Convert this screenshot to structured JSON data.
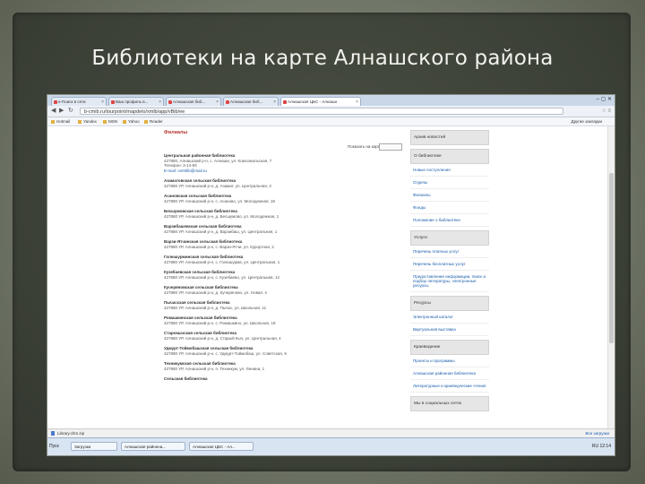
{
  "slide": {
    "title": "Библиотеки на карте Алнашского района"
  },
  "browser": {
    "tabs": [
      {
        "label": "e-Поиск в сети"
      },
      {
        "label": "Ваш профиль в..."
      },
      {
        "label": "Алнашская биб..."
      },
      {
        "label": "Алнашская биб..."
      },
      {
        "label": "Алнашская ЦБС - Алнаши"
      }
    ],
    "url": "b-cmib.ru/tourpoint/mapdelo/xmlb/app/vBib/ee",
    "bookmarks": [
      "Hotmail",
      "Yandex",
      "MSN",
      "Yahoo",
      "Reader"
    ],
    "other_bookmarks": "Другие закладки",
    "download": "Library.chm.zip",
    "download_all": "Все загрузки"
  },
  "main": {
    "heading": "Филиалы",
    "addr_label": "Показать на карте",
    "libraries": [
      {
        "name": "Центральная районная библиотека",
        "address": "427880, Алнашский р-н, с. Алнаши, ул. Комсомольская, 7",
        "phone": "Телефон: 3-14-93",
        "email": "E-mail: centrlib@mail.ru"
      },
      {
        "name": "Азаматовская сельская библиотека",
        "address": "427886 УР, Алнашский р-н, д. Азамат, ул. Центральная, 3"
      },
      {
        "name": "Асановская сельская библиотека",
        "address": "427880 УР, Алнашский р-н, с. Асаново, ул. Молодежная, 18"
      },
      {
        "name": "Бесшумовская сельская библиотека",
        "address": "427880 УР, Алнашский р-н, д. Бесшумово, ул. Молодежная, 1"
      },
      {
        "name": "Варзибашевская сельская библиотека",
        "address": "427880 УР, Алнашский р-н, д. Варзибаш, ул. Центральная, 1"
      },
      {
        "name": "Варзи-Ятчинская сельская библиотека",
        "address": "427880 УР, Алнашский р-н, с. Варзи-Ятчи, ул. Курортная, 2"
      },
      {
        "name": "Голюшурминская сельская библиотека",
        "address": "427880 УР, Алнашский р-н, с. Голюшурма, ул. Центральная, 1"
      },
      {
        "name": "Кузебаевская сельская библиотека",
        "address": "427880 УР, Алнашский р-н, с. Кузебаево, ул. Центральная, 12"
      },
      {
        "name": "Кучеряновская сельская библиотека",
        "address": "427880 УР, Алнашский р-н, д. Кучеряново, ул. Новая, 4"
      },
      {
        "name": "Пычасская сельская библиотека",
        "address": "427880 УР, Алнашский р-н, д. Пычас, ул. Школьная, 11"
      },
      {
        "name": "Ромашкинская сельская библиотека",
        "address": "427880 УР, Алнашский р-н, с. Ромашкино, ул. Школьная, 18"
      },
      {
        "name": "Старокычская сельская библиотека",
        "address": "427880 УР, Алнашский р-н, д. Старый Кыч, ул. Центральная, 4"
      },
      {
        "name": "Удмурт-Тоймобашская сельская библиотека",
        "address": "427880 УР, Алнашский р-н, с. Удмурт-Тоймобаш, ул. Советская, 9"
      },
      {
        "name": "Техникумская сельская библиотека",
        "address": "427880 УР, Алнашский р-н, п. Техникум, ул. Ленина, 1"
      },
      {
        "name": "Сельская библиотека",
        "address": ""
      }
    ]
  },
  "sidebar": {
    "blocks": [
      {
        "head": "Архив новостей",
        "items": []
      },
      {
        "head": "О библиотеке",
        "items": [
          "Новые поступления",
          "Отделы",
          "Филиалы",
          "Фонды",
          "Положение о библиотеке"
        ]
      },
      {
        "head": "Услуги",
        "items": [
          "Перечень платных услуг",
          "Перечень бесплатных услуг",
          "Предоставление информации, поиск и подбор литературы, электронные ресурсы"
        ]
      },
      {
        "head": "Ресурсы",
        "items": [
          "Электронный каталог",
          "Виртуальная выставка"
        ]
      },
      {
        "head": "Краеведение",
        "items": [
          "Проекты и программы",
          "Алнашская районная библиотека",
          "Литературные и краеведческие чтения"
        ]
      },
      {
        "head": "Мы в социальных сетях",
        "items": []
      }
    ]
  },
  "taskbar": {
    "start": "Пуск",
    "items": [
      "Загрузки",
      "Алнашская районна...",
      "Алнашская ЦБС - Ал..."
    ],
    "tray": "RU  12:14"
  }
}
